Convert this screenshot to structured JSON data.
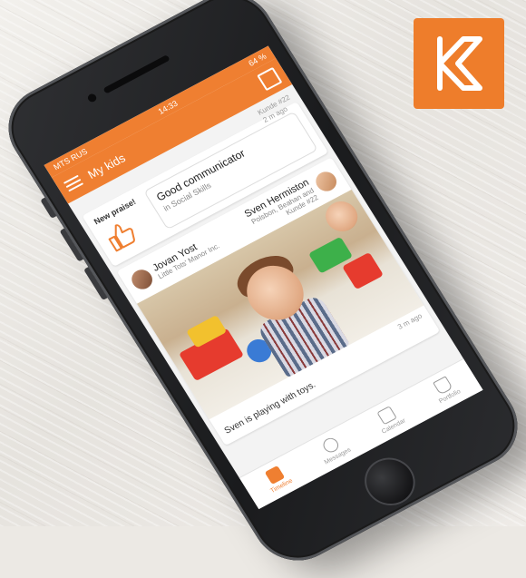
{
  "logo": {
    "icon": "k-logo-icon",
    "color": "#ee7d2b"
  },
  "status_bar": {
    "carrier": "MTS RUS",
    "time": "14:33",
    "battery": "64 %"
  },
  "app_bar": {
    "title": "My kids",
    "accent": "#ef7f31"
  },
  "partial_top": {
    "text": "Kunde #22"
  },
  "praise_card": {
    "label": "New praise!",
    "title": "Good communicator",
    "subtitle": "in Social Skills",
    "time": "2 m ago"
  },
  "post": {
    "author_name": "Jovan Yost",
    "author_org": "Little Tots' Manor Inc.",
    "child_name": "Sven Hermiston",
    "child_detail_1": "Polsbon, Beahan and",
    "child_detail_2": "Kunde #22",
    "time": "3 m ago",
    "caption": "Sven is playing with toys."
  },
  "tabs": [
    {
      "label": "Timeline",
      "icon": "timeline-icon",
      "active": true
    },
    {
      "label": "Messages",
      "icon": "chat-icon",
      "active": false
    },
    {
      "label": "Calendar",
      "icon": "calendar-icon",
      "active": false
    },
    {
      "label": "Portfolio",
      "icon": "graduation-cap-icon",
      "active": false
    }
  ]
}
